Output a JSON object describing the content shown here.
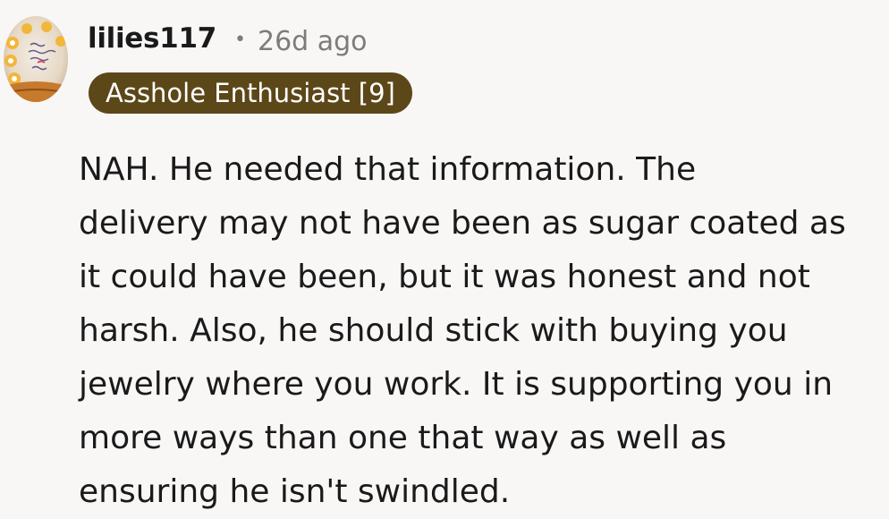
{
  "comment": {
    "avatar_icon": "user-avatar-icon",
    "username": "lilies117",
    "separator": "•",
    "timestamp": "26d ago",
    "flair": "Asshole Enthusiast [9]",
    "flair_color": "#5c4718",
    "body_lines": [
      "NAH. He needed that information. The",
      "delivery may not have been as sugar coated as",
      "it could have been, but it was honest and not",
      "harsh. Also, he should stick with buying you",
      "jewelry where you work. It is supporting you in",
      "more ways than one that way as well as",
      "ensuring he isn't swindled."
    ]
  }
}
